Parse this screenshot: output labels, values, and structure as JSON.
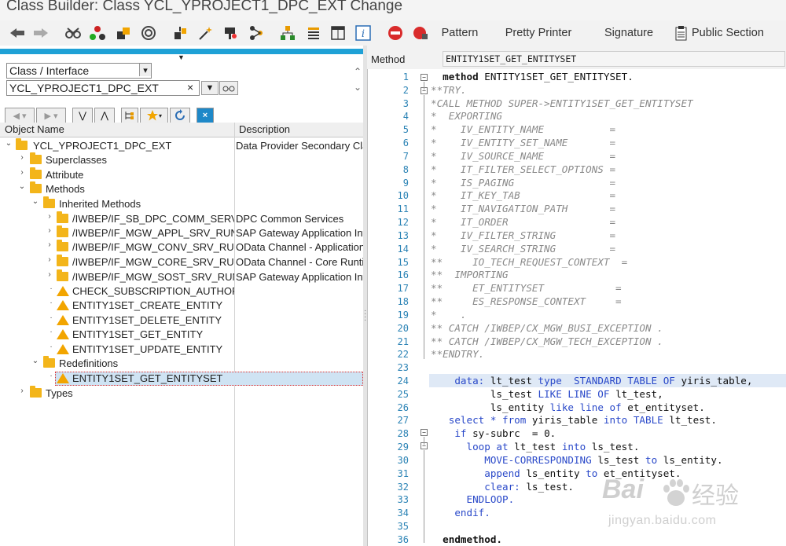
{
  "title": "Class Builder: Class YCL_YPROJECT1_DPC_EXT Change",
  "toolbar": {
    "icons": [
      "back-icon",
      "forward-icon",
      "glasses-icon",
      "tree-icon",
      "activate-icon",
      "where-used-icon",
      "object-icon",
      "magic-icon",
      "object-list-icon",
      "hierarchy-icon",
      "list-icon",
      "document-icon",
      "info-icon",
      "stop-icon",
      "breakpoint-icon"
    ],
    "pattern": "Pattern",
    "pretty_printer": "Pretty Printer",
    "signature": "Signature",
    "public_section": "Public Section"
  },
  "left": {
    "object_type": "Class / Interface",
    "object_name": "YCL_YPROJECT1_DPC_EXT",
    "col_object": "Object Name",
    "col_desc": "Description",
    "tree": [
      {
        "label": "YCL_YPROJECT1_DPC_EXT",
        "desc": "Data Provider Secondary Class"
      },
      {
        "label": "Superclasses",
        "desc": ""
      },
      {
        "label": "Attribute",
        "desc": ""
      },
      {
        "label": "Methods",
        "desc": ""
      },
      {
        "label": "Inherited Methods",
        "desc": ""
      },
      {
        "label": "/IWBEP/IF_SB_DPC_COMM_SERVICES",
        "desc": "DPC Common Services"
      },
      {
        "label": "/IWBEP/IF_MGW_APPL_SRV_RUNTIME",
        "desc": "SAP Gateway Application Interface"
      },
      {
        "label": "/IWBEP/IF_MGW_CONV_SRV_RUNTIME",
        "desc": "OData Channel - Application Conversion"
      },
      {
        "label": "/IWBEP/IF_MGW_CORE_SRV_RUNTIME",
        "desc": "OData Channel - Core Runtime"
      },
      {
        "label": "/IWBEP/IF_MGW_SOST_SRV_RUNTIME",
        "desc": "SAP Gateway Application Interface"
      },
      {
        "label": "CHECK_SUBSCRIPTION_AUTHORITY",
        "desc": ""
      },
      {
        "label": "ENTITY1SET_CREATE_ENTITY",
        "desc": ""
      },
      {
        "label": "ENTITY1SET_DELETE_ENTITY",
        "desc": ""
      },
      {
        "label": "ENTITY1SET_GET_ENTITY",
        "desc": ""
      },
      {
        "label": "ENTITY1SET_UPDATE_ENTITY",
        "desc": ""
      },
      {
        "label": "Redefinitions",
        "desc": ""
      },
      {
        "label": "ENTITY1SET_GET_ENTITYSET",
        "desc": ""
      },
      {
        "label": "Types",
        "desc": ""
      }
    ]
  },
  "right": {
    "method_label": "Method",
    "method_name": "ENTITY1SET_GET_ENTITYSET",
    "lines": [
      "1",
      "2",
      "3",
      "4",
      "5",
      "6",
      "7",
      "8",
      "9",
      "10",
      "11",
      "12",
      "13",
      "14",
      "15",
      "16",
      "17",
      "18",
      "19",
      "20",
      "21",
      "22",
      "23",
      "24",
      "25",
      "26",
      "27",
      "28",
      "29",
      "30",
      "31",
      "32",
      "33",
      "34",
      "35",
      "36"
    ],
    "code": {
      "l1a": "  method ",
      "l1b": "ENTITY1SET_GET_ENTITYSET.",
      "l2": "**TRY.",
      "l3": "*CALL METHOD SUPER->ENTITY1SET_GET_ENTITYSET",
      "l4": "*  EXPORTING",
      "l5": "*    IV_ENTITY_NAME           =",
      "l6": "*    IV_ENTITY_SET_NAME       =",
      "l7": "*    IV_SOURCE_NAME           =",
      "l8": "*    IT_FILTER_SELECT_OPTIONS =",
      "l9": "*    IS_PAGING                =",
      "l10": "*    IT_KEY_TAB               =",
      "l11": "*    IT_NAVIGATION_PATH       =",
      "l12": "*    IT_ORDER                 =",
      "l13": "*    IV_FILTER_STRING         =",
      "l14": "*    IV_SEARCH_STRING         =",
      "l15": "**     IO_TECH_REQUEST_CONTEXT  =",
      "l16": "**  IMPORTING",
      "l17": "**     ET_ENTITYSET            =",
      "l18": "**     ES_RESPONSE_CONTEXT     =",
      "l19": "*    .",
      "l20": "** CATCH /IWBEP/CX_MGW_BUSI_EXCEPTION .",
      "l21": "** CATCH /IWBEP/CX_MGW_TECH_EXCEPTION .",
      "l22": "**ENDTRY.",
      "l24a": "    data: ",
      "l24b": "lt_test ",
      "l24c": "type  STANDARD TABLE OF ",
      "l24d": "yiris_table,",
      "l25a": "          ls_test ",
      "l25b": "LIKE LINE OF ",
      "l25c": "lt_test,",
      "l26a": "          ls_entity ",
      "l26b": "like line of ",
      "l26c": "et_entityset.",
      "l27a": "   select * from ",
      "l27b": "yiris_table ",
      "l27c": "into TABLE ",
      "l27d": "lt_test.",
      "l28a": "    if ",
      "l28b": "sy-subrc  = 0.",
      "l29a": "      loop at ",
      "l29b": "lt_test ",
      "l29c": "into ",
      "l29d": "ls_test.",
      "l30a": "         MOVE-CORRESPONDING ",
      "l30b": "ls_test ",
      "l30c": "to ",
      "l30d": "ls_entity.",
      "l31a": "         append ",
      "l31b": "ls_entity ",
      "l31c": "to ",
      "l31d": "et_entityset.",
      "l32a": "         clear: ",
      "l32b": "ls_test.",
      "l33": "      ENDLOOP.",
      "l34": "    endif.",
      "l36": "  endmethod."
    }
  },
  "watermark": {
    "brand": "Bai",
    "brand2": "经验",
    "url": "jingyan.baidu.com"
  }
}
